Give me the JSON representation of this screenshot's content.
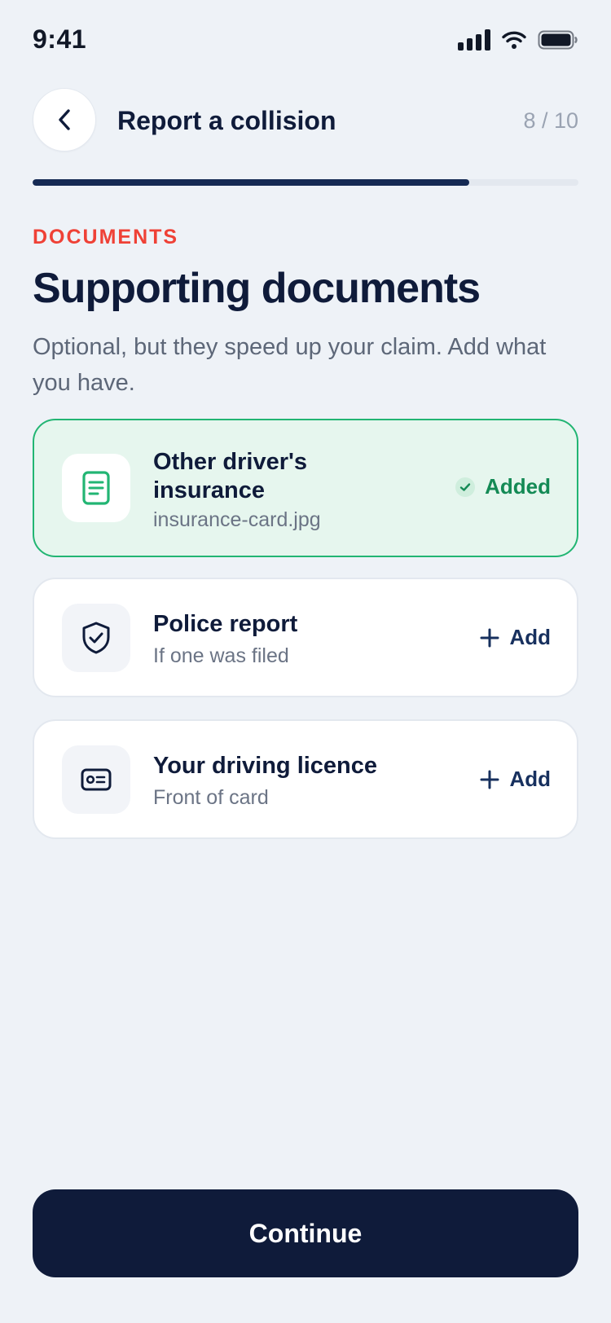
{
  "status_bar": {
    "time": "9:41"
  },
  "header": {
    "title": "Report a collision",
    "step": "8 / 10",
    "progress_fraction": 0.8
  },
  "intro": {
    "eyebrow": "DOCUMENTS",
    "title": "Supporting documents",
    "subtitle": "Optional, but they speed up your claim. Add what you have."
  },
  "documents": [
    {
      "title": "Other driver's insurance",
      "subtitle": "insurance-card.jpg",
      "action": "Added",
      "status": "added",
      "icon": "document-icon"
    },
    {
      "title": "Police report",
      "subtitle": "If one was filed",
      "action": "Add",
      "status": "pending",
      "icon": "shield-check-icon"
    },
    {
      "title": "Your driving licence",
      "subtitle": "Front of card",
      "action": "Add",
      "status": "pending",
      "icon": "id-card-icon"
    }
  ],
  "footer": {
    "continue_label": "Continue"
  },
  "colors": {
    "background": "#eef2f7",
    "primary": "#0f1b3a",
    "accent_red": "#ef4136",
    "success": "#22b573",
    "success_bg": "#e6f6ee"
  }
}
